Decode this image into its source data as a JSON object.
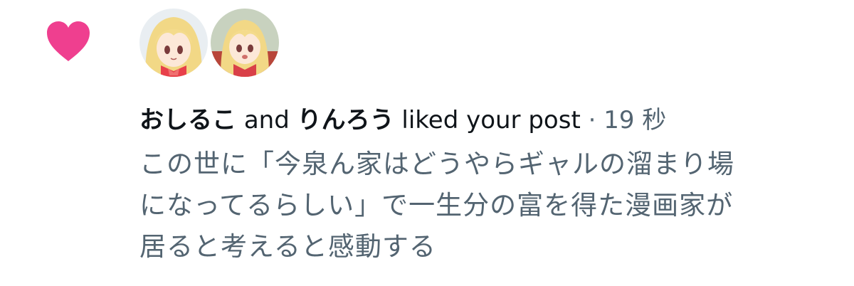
{
  "notification": {
    "type_icon": "heart-icon",
    "accent_color": "#f91880",
    "avatars": [
      {
        "icon": "avatar-anime-girl-bow-icon"
      },
      {
        "icon": "avatar-anime-girl-shrine-icon"
      }
    ],
    "user1": "おしるこ",
    "conjunction": "and",
    "user2": "りんろう",
    "action": "liked your post",
    "separator": "·",
    "time": "19 秒",
    "post_lines": [
      "この世に「今泉ん家はどうやらギャルの溜まり場",
      "になってるらしい」で一生分の富を得た漫画家が",
      "居ると考えると感動する"
    ]
  }
}
